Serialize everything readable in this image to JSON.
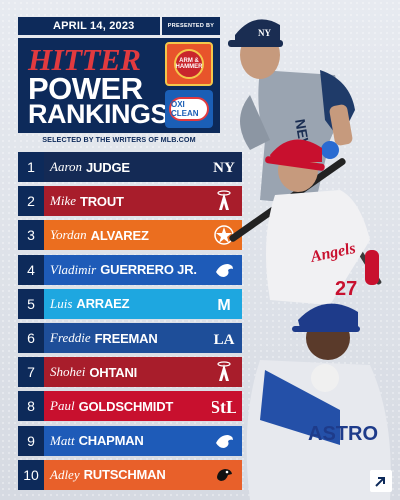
{
  "header": {
    "date": "APRIL 14, 2023",
    "presented_by": "PRESENTED BY",
    "title_line1": "HITTER",
    "title_line2": "POWER",
    "title_line3": "RANKINGS",
    "sponsor1": "ARM & HAMMER",
    "sponsor2": "OXI CLEAN",
    "selected_by": "SELECTED BY THE WRITERS OF MLB.COM"
  },
  "colors": {
    "navy": "#0d2a5a",
    "yankees": "#142a55",
    "angels": "#a81d2b",
    "astros": "#eb6e1f",
    "bluejays": "#1e5bb8",
    "marlins": "#1ea7e0",
    "dodgers": "#1e4e99",
    "cardinals": "#c8102e",
    "orioles": "#e8602a"
  },
  "rankings": [
    {
      "rank": "1",
      "first": "Aaron",
      "last": "JUDGE",
      "team": "yankees",
      "color": "#142a55"
    },
    {
      "rank": "2",
      "first": "Mike",
      "last": "TROUT",
      "team": "angels",
      "color": "#a81d2b"
    },
    {
      "rank": "3",
      "first": "Yordan",
      "last": "ALVAREZ",
      "team": "astros",
      "color": "#eb6e1f"
    },
    {
      "rank": "4",
      "first": "Vladimir",
      "last": "GUERRERO JR.",
      "team": "bluejays",
      "color": "#1e5bb8"
    },
    {
      "rank": "5",
      "first": "Luis",
      "last": "ARRAEZ",
      "team": "marlins",
      "color": "#1ea7e0"
    },
    {
      "rank": "6",
      "first": "Freddie",
      "last": "FREEMAN",
      "team": "dodgers",
      "color": "#1e4e99"
    },
    {
      "rank": "7",
      "first": "Shohei",
      "last": "OHTANI",
      "team": "angels",
      "color": "#a81d2b"
    },
    {
      "rank": "8",
      "first": "Paul",
      "last": "GOLDSCHMIDT",
      "team": "cardinals",
      "color": "#c8102e"
    },
    {
      "rank": "9",
      "first": "Matt",
      "last": "CHAPMAN",
      "team": "bluejays",
      "color": "#1e5bb8"
    },
    {
      "rank": "10",
      "first": "Adley",
      "last": "RUTSCHMAN",
      "team": "orioles",
      "color": "#e8602a"
    }
  ],
  "icons": {
    "yankees": "yankees-logo-icon",
    "angels": "angels-logo-icon",
    "astros": "astros-logo-icon",
    "bluejays": "bluejays-logo-icon",
    "marlins": "marlins-logo-icon",
    "dodgers": "dodgers-logo-icon",
    "cardinals": "cardinals-logo-icon",
    "orioles": "orioles-logo-icon",
    "corner": "arrow-corner-icon"
  },
  "jerseys": {
    "judge_letters": "NEW",
    "trout_text": "Angels",
    "trout_number": "27",
    "alvarez_text": "ASTRO"
  }
}
